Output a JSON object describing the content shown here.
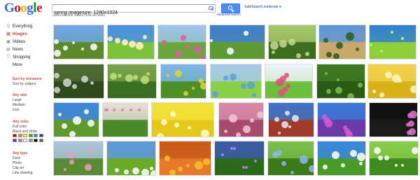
{
  "header": {
    "logo_letters": [
      {
        "ch": "G",
        "color": "#3369e8"
      },
      {
        "ch": "o",
        "color": "#d50f25"
      },
      {
        "ch": "o",
        "color": "#eeb211"
      },
      {
        "ch": "g",
        "color": "#3369e8"
      },
      {
        "ch": "l",
        "color": "#009925"
      },
      {
        "ch": "e",
        "color": "#d50f25"
      }
    ],
    "search_value": "spring imagesize: 1280x1024",
    "safesearch_label": "SafeSearch moderate ▾",
    "advanced_label": "Advanced search",
    "result_stats": "About 648,000 results (0.65 seconds)"
  },
  "sidebar": {
    "nav": [
      {
        "label": "Everything",
        "icon": "search-icon",
        "glyph": "⚲",
        "active": false
      },
      {
        "label": "Images",
        "icon": "images-icon",
        "glyph": "▦",
        "active": true
      },
      {
        "label": "Videos",
        "icon": "videos-icon",
        "glyph": "▣",
        "active": false
      },
      {
        "label": "News",
        "icon": "news-icon",
        "glyph": "▤",
        "active": false
      },
      {
        "label": "Shopping",
        "icon": "shopping-icon",
        "glyph": "⛉",
        "active": false
      }
    ],
    "more_label": "More",
    "sort": {
      "heading": "Sort by relevance",
      "options": [
        "Sort by subject"
      ]
    },
    "size": {
      "heading": "Any size",
      "options": [
        "Large",
        "Medium",
        "Icon"
      ]
    },
    "color": {
      "heading": "Any color",
      "options": [
        "Full color",
        "Black and white"
      ],
      "swatches": [
        "#cc0000",
        "#ff8800",
        "#ffee00",
        "#33aa00",
        "#00aaaa",
        "#1133cc",
        "#7722aa",
        "#ee66cc",
        "#ffffff",
        "#999999",
        "#000000",
        "#885522"
      ]
    },
    "type": {
      "heading": "Any type",
      "options": [
        "Face",
        "Photo",
        "Clip art",
        "Line drawing"
      ]
    }
  },
  "images": [
    {
      "name": "white-daisies-blue-sky",
      "sky": "#6fa8e8",
      "ground": "#5c8a2a",
      "accent": "#ffffff"
    },
    {
      "name": "sunny-green-meadow",
      "sky": "#4a90e2",
      "ground": "#7cc23a",
      "accent": "#fff7c0"
    },
    {
      "name": "pink-blossom-trees",
      "sky": "#9fc4ea",
      "ground": "#6aa63a",
      "accent": "#e05aa0"
    },
    {
      "name": "mountain-valley",
      "sky": "#3f7fd0",
      "ground": "#5f9b34",
      "accent": "#e8eef4"
    },
    {
      "name": "green-forest-path",
      "sky": "#a8c96c",
      "ground": "#3d6e1e",
      "accent": "#c8d88a"
    },
    {
      "name": "lone-tree-hill",
      "sky": "#5d96d8",
      "ground": "#c9a96a",
      "accent": "#2f5a1c"
    },
    {
      "name": "green-leaves-closeup",
      "sky": "#2f7fd0",
      "ground": "#8fd03a",
      "accent": "#c6ec6a"
    },
    {
      "name": "forest-stream",
      "sky": "#4f6a32",
      "ground": "#2e4a1c",
      "accent": "#cfd9d2"
    },
    {
      "name": "green-park-path",
      "sky": "#7aa24a",
      "ground": "#3b6e22",
      "accent": "#bfe07a"
    },
    {
      "name": "flower-field-sky",
      "sky": "#7db6ea",
      "ground": "#4f8f2a",
      "accent": "#e8d22c"
    },
    {
      "name": "grass-waterfront",
      "sky": "#a6cbe8",
      "ground": "#8ccf4a",
      "accent": "#5c9fd8"
    },
    {
      "name": "tulips-colorful",
      "sky": "#eef3f7",
      "ground": "#6bbf3a",
      "accent": "#e84a7a"
    },
    {
      "name": "green-foliage",
      "sky": "#3f7a22",
      "ground": "#2a5a14",
      "accent": "#7cc04a"
    },
    {
      "name": "yellow-rapeseed-field",
      "sky": "#f2d24a",
      "ground": "#d9b21a",
      "accent": "#fff6c0"
    },
    {
      "name": "daisies-blue-sky",
      "sky": "#3d86e0",
      "ground": "#5e9a2c",
      "accent": "#ffffff"
    },
    {
      "name": "pink-tree-garden",
      "sky": "#e6e0d8",
      "ground": "#4a8a2a",
      "accent": "#e870a8"
    },
    {
      "name": "yellow-bokeh",
      "sky": "#f3e23a",
      "ground": "#e6c81a",
      "accent": "#fffbd0"
    },
    {
      "name": "pink-cherry-blossoms",
      "sky": "#d88aa8",
      "ground": "#a84a6c",
      "accent": "#f2c6d6"
    },
    {
      "name": "snowy-mountain-lake",
      "sky": "#3d74c8",
      "ground": "#a03a2a",
      "accent": "#e4eaf2"
    },
    {
      "name": "blue-purple-flowers",
      "sky": "#3a7ad8",
      "ground": "#6a3aa8",
      "accent": "#d85ad0"
    },
    {
      "name": "colorful-flowers-black",
      "sky": "#101010",
      "ground": "#1a1a1a",
      "accent": "#e070d0"
    },
    {
      "name": "blossom-tree-rider",
      "sky": "#aac6e0",
      "ground": "#5a8a34",
      "accent": "#e8a0c0"
    },
    {
      "name": "fence-green-field",
      "sky": "#5e98e0",
      "ground": "#6aaa2a",
      "accent": "#ffffff"
    },
    {
      "name": "orange-poppy-field",
      "sky": "#c85a1a",
      "ground": "#e8782a",
      "accent": "#f4c02a"
    },
    {
      "name": "flower-meadow-clouds",
      "sky": "#3a5aa8",
      "ground": "#2a6a1a",
      "accent": "#b888e0"
    },
    {
      "name": "forget-me-nots",
      "sky": "#7fbf4a",
      "ground": "#3a7a1a",
      "accent": "#8ab8f0"
    },
    {
      "name": "hill-blue-sky",
      "sky": "#3a86e0",
      "ground": "#4a9a2a",
      "accent": "#ffffff"
    },
    {
      "name": "white-bells-flowers",
      "sky": "#8acf4a",
      "ground": "#3e8a1e",
      "accent": "#ffffff"
    }
  ]
}
